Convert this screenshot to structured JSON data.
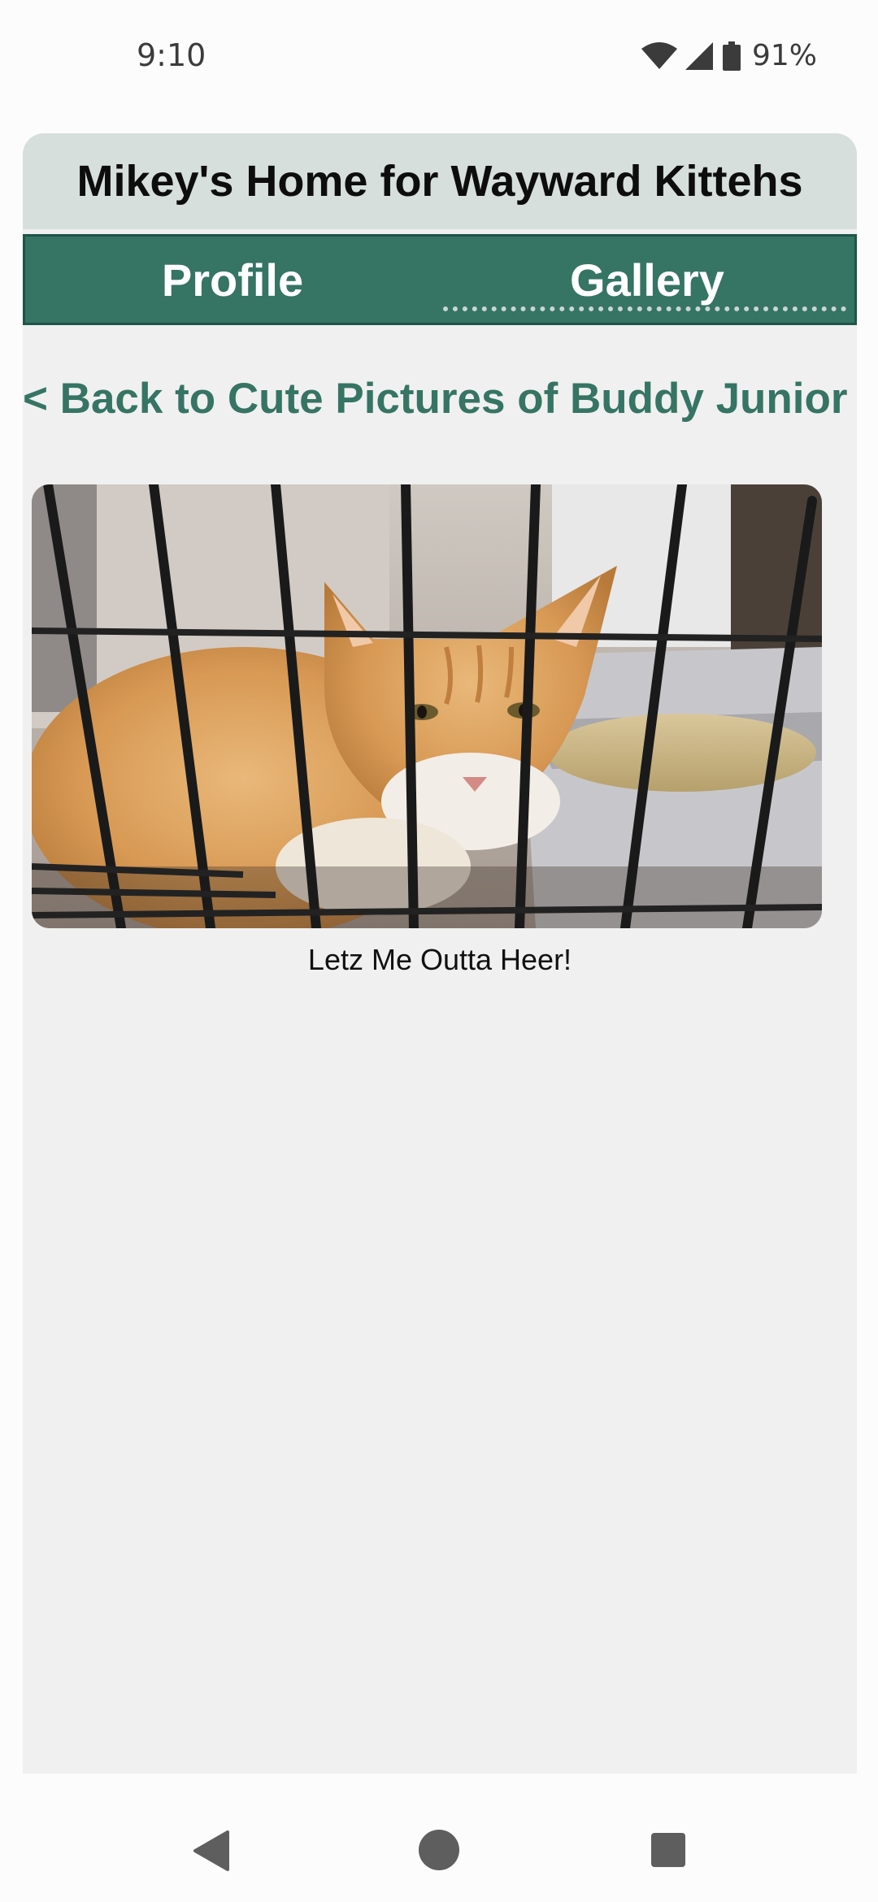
{
  "status_bar": {
    "time": "9:10",
    "battery": "91%",
    "icons": [
      "wifi-icon",
      "cell-signal-icon",
      "battery-icon"
    ]
  },
  "app": {
    "title": "Mikey's Home for Wayward Kittehs",
    "nav": {
      "tabs": [
        {
          "label": "Profile",
          "active": false
        },
        {
          "label": "Gallery",
          "active": true
        }
      ]
    },
    "back_link": "< Back to Cute Pictures of Buddy Junior",
    "photo": {
      "subject": "orange tabby cat behind cage bars"
    },
    "caption": "Letz Me Outta Heer!"
  },
  "system_nav": {
    "icons": [
      "back-triangle-icon",
      "home-circle-icon",
      "recents-square-icon"
    ]
  },
  "colors": {
    "header_bg": "#d6dfdc",
    "nav_bg": "#367464",
    "link": "#367464",
    "content_bg": "#f0f0f0"
  }
}
